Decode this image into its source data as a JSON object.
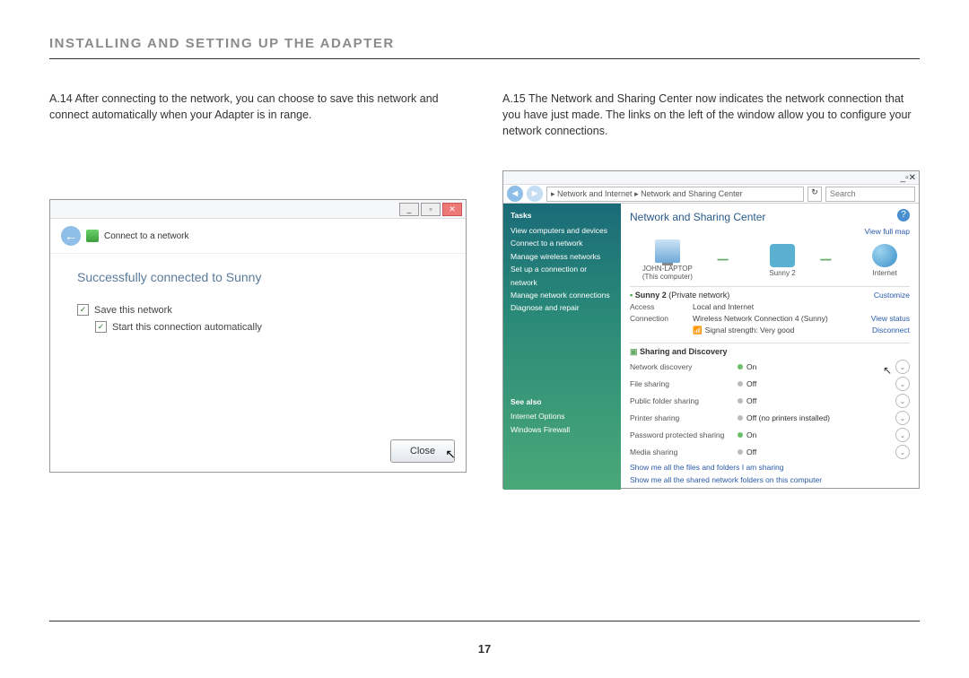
{
  "section_title": "INSTALLING AND SETTING UP THE ADAPTER",
  "page_number": "17",
  "left": {
    "step": "A.14 After connecting to the network, you can choose to save this network and connect automatically when your Adapter is in range.",
    "shot": {
      "title": "Connect to a network",
      "success": "Successfully connected to Sunny",
      "cb1": "Save this network",
      "cb2": "Start this connection automatically",
      "close": "Close"
    }
  },
  "right": {
    "step": "A.15 The Network and Sharing Center now indicates the network connection that you have just made. The links on the left of the window allow you to configure your network connections.",
    "shot": {
      "address": "▸ Network and Internet ▸ Network and Sharing Center",
      "search_ph": "Search",
      "sidebar": {
        "tasks": "Tasks",
        "i0": "View computers and devices",
        "i1": "Connect to a network",
        "i2": "Manage wireless networks",
        "i3": "Set up a connection or network",
        "i4": "Manage network connections",
        "i5": "Diagnose and repair",
        "seealso": "See also",
        "s0": "Internet Options",
        "s1": "Windows Firewall"
      },
      "panel_title": "Network and Sharing Center",
      "full_map": "View full map",
      "map": {
        "pc": "JOHN-LAPTOP",
        "pc_sub": "(This computer)",
        "net": "Sunny 2",
        "inet": "Internet"
      },
      "net_name": "Sunny 2",
      "net_type": "(Private network)",
      "customize": "Customize",
      "access_k": "Access",
      "access_v": "Local and Internet",
      "conn_k": "Connection",
      "conn_v": "Wireless Network Connection 4 (Sunny)",
      "view_status": "View status",
      "signal": "Signal strength: Very good",
      "disconnect": "Disconnect",
      "sd_title": "Sharing and Discovery",
      "sd": [
        {
          "label": "Network discovery",
          "val": "On",
          "on": true
        },
        {
          "label": "File sharing",
          "val": "Off",
          "on": false
        },
        {
          "label": "Public folder sharing",
          "val": "Off",
          "on": false
        },
        {
          "label": "Printer sharing",
          "val": "Off (no printers installed)",
          "on": false
        },
        {
          "label": "Password protected sharing",
          "val": "On",
          "on": true
        },
        {
          "label": "Media sharing",
          "val": "Off",
          "on": false
        }
      ],
      "show1": "Show me all the files and folders I am sharing",
      "show2": "Show me all the shared network folders on this computer"
    }
  }
}
